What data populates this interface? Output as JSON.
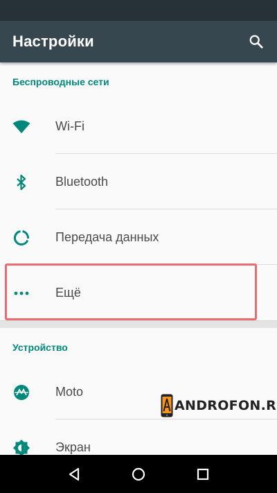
{
  "app_bar": {
    "title": "Настройки",
    "search_icon": "search-icon"
  },
  "sections": [
    {
      "header": "Беспроводные сети",
      "items": [
        {
          "label": "Wi-Fi",
          "icon": "wifi-icon"
        },
        {
          "label": "Bluetooth",
          "icon": "bluetooth-icon"
        },
        {
          "label": "Передача данных",
          "icon": "data-usage-icon"
        },
        {
          "label": "Ещё",
          "icon": "more-icon",
          "highlighted": true
        }
      ]
    },
    {
      "header": "Устройство",
      "items": [
        {
          "label": "Moto",
          "icon": "moto-icon"
        },
        {
          "label": "Экран",
          "icon": "brightness-icon"
        }
      ]
    }
  ],
  "watermark": {
    "text": "ANDROFON.RU",
    "logo_letter": "A"
  },
  "nav_bar": {
    "back": "back-icon",
    "home": "home-icon",
    "recents": "recents-icon"
  },
  "colors": {
    "accent": "#00897b",
    "app_bar": "#37474f",
    "status_bar": "#263238",
    "highlight": "#ec6b73"
  }
}
